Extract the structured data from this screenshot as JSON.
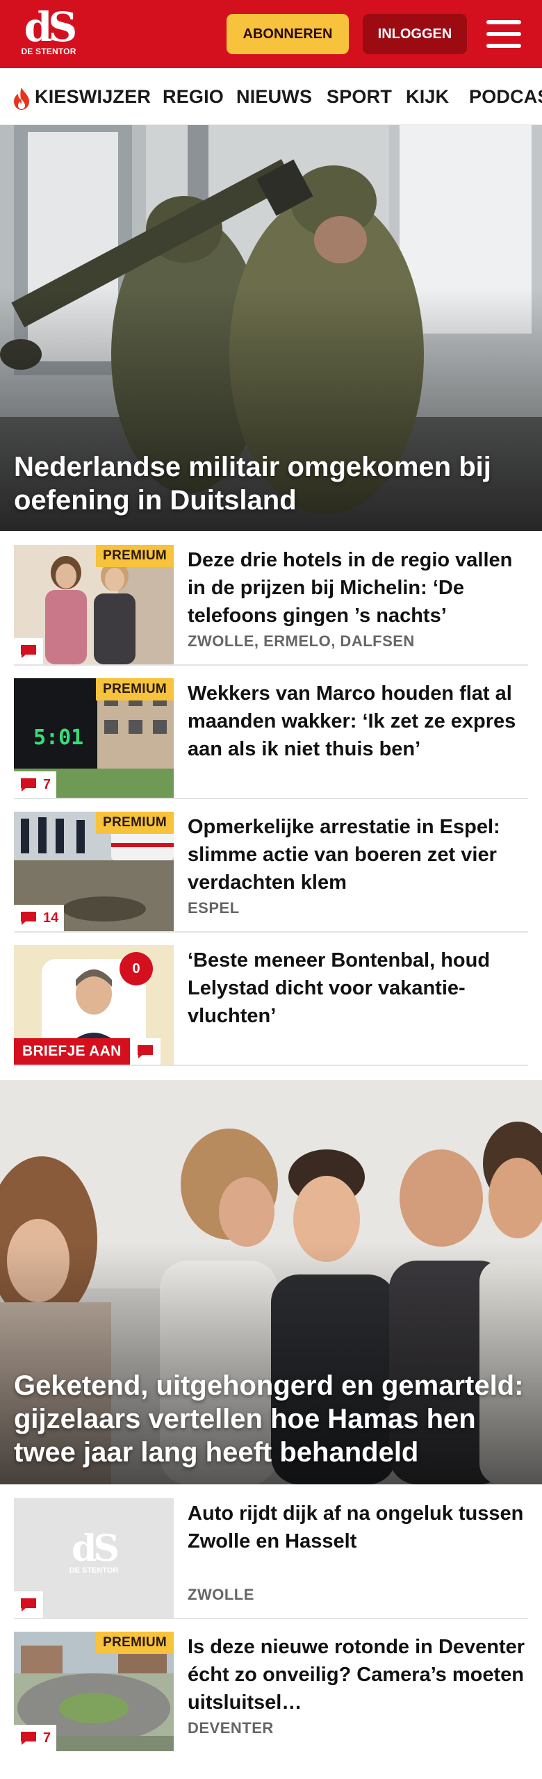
{
  "header": {
    "logo_mark": "dS",
    "logo_text": "DE STENTOR",
    "subscribe_label": "ABONNEREN",
    "login_label": "INLOGGEN",
    "brand_color": "#d5101e"
  },
  "nav": {
    "items": [
      {
        "label": "KIESWIJZER",
        "icon": "flame-icon"
      },
      {
        "label": "REGIO"
      },
      {
        "label": "NIEUWS"
      },
      {
        "label": "SPORT"
      },
      {
        "label": "KIJK"
      },
      {
        "label": "PODCAS"
      }
    ]
  },
  "hero1": {
    "title": "Nederlandse militair omgekomen bij oefening in Duitsland"
  },
  "articles_a": [
    {
      "badge": "PREMIUM",
      "title": "Deze drie hotels in de regio vallen in de prijzen bij Michelin: ‘De telefoons gingen ’s nachts’",
      "location": "ZWOLLE, ERMELO, DALFSEN",
      "comments": ""
    },
    {
      "badge": "PREMIUM",
      "title": "Wekkers van Marco houden flat al maanden wakker: ‘Ik zet ze expres aan als ik niet thuis ben’",
      "location": "",
      "comments": "7",
      "clock_text": "5:01"
    },
    {
      "badge": "PREMIUM",
      "title": "Opmerkelijke arrestatie in Espel: slimme actie van boeren zet vier verdachten klem",
      "location": "ESPEL",
      "comments": "14"
    },
    {
      "badge": "",
      "title": "‘Beste meneer Bontenbal, houd Lelystad dicht voor vakantie-vluchten’",
      "location": "",
      "label": "BRIEFJE AAN",
      "notification": "0"
    }
  ],
  "hero2": {
    "title": "Geketend, uitgehongerd en gemarteld: gijzelaars vertellen hoe Hamas hen twee jaar lang heeft behandeld"
  },
  "articles_b": [
    {
      "badge": "",
      "title": "Auto rijdt dijk af na ongeluk tussen Zwolle en Hasselt",
      "location": "ZWOLLE",
      "comments": ""
    },
    {
      "badge": "PREMIUM",
      "title": "Is deze nieuwe rotonde in Deventer écht zo onveilig? Camera’s moeten uitsluitsel…",
      "location": "DEVENTER",
      "comments": "7"
    }
  ]
}
